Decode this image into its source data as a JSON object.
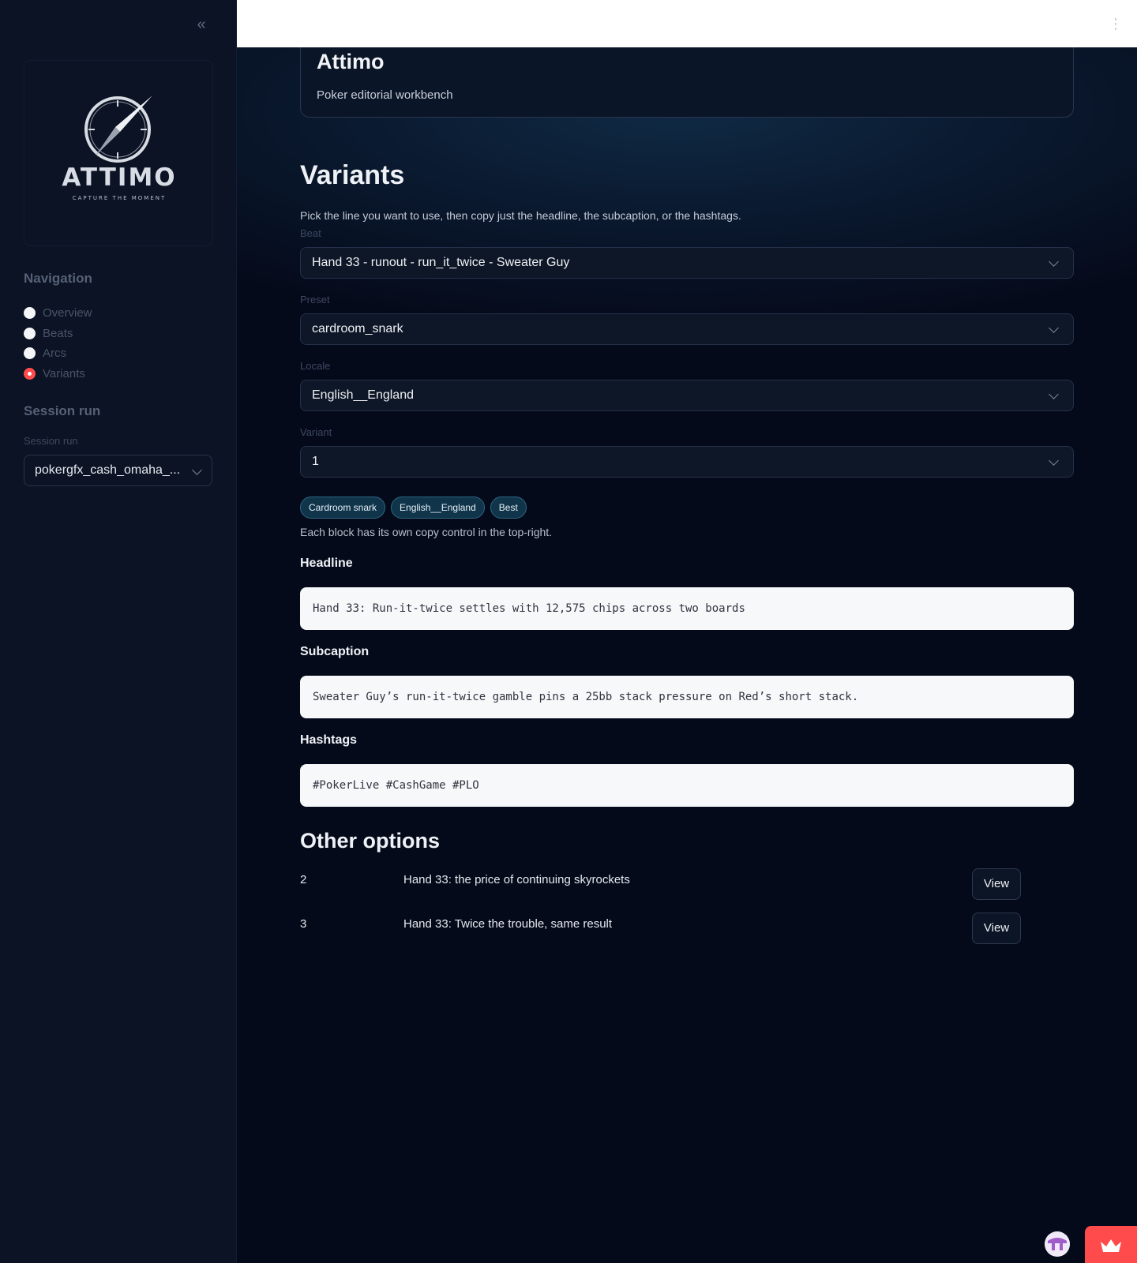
{
  "sidebar": {
    "logo": {
      "wordmark": "ATTIMO",
      "tagline": "CAPTURE THE MOMENT"
    },
    "navigation_heading": "Navigation",
    "nav_items": [
      {
        "label": "Overview",
        "selected": false
      },
      {
        "label": "Beats",
        "selected": false
      },
      {
        "label": "Arcs",
        "selected": false
      },
      {
        "label": "Variants",
        "selected": true
      }
    ],
    "session_heading": "Session run",
    "session_label": "Session run",
    "session_value": "pokergfx_cash_omaha_..."
  },
  "header": {
    "title": "Attimo",
    "subtitle": "Poker editorial workbench"
  },
  "main": {
    "title": "Variants",
    "intro": "Pick the line you want to use, then copy just the headline, the subcaption, or the hashtags.",
    "fields": {
      "beat": {
        "label": "Beat",
        "value": "Hand 33 - runout - run_it_twice - Sweater Guy"
      },
      "preset": {
        "label": "Preset",
        "value": "cardroom_snark"
      },
      "locale": {
        "label": "Locale",
        "value": "English__England"
      },
      "variant": {
        "label": "Variant",
        "value": "1"
      }
    },
    "chips": [
      "Cardroom snark",
      "English__England",
      "Best"
    ],
    "note": "Each block has its own copy control in the top-right.",
    "headline": {
      "label": "Headline",
      "text": "Hand 33: Run-it-twice settles with 12,575 chips across two boards"
    },
    "subcaption": {
      "label": "Subcaption",
      "text": "Sweater Guy’s run-it-twice gamble pins a 25bb stack pressure on Red’s short stack."
    },
    "hashtags": {
      "label": "Hashtags",
      "text": "#PokerLive #CashGame #PLO"
    },
    "other_options": {
      "title": "Other options",
      "rows": [
        {
          "num": "2",
          "text": "Hand 33: the price of continuing skyrockets",
          "button": "View"
        },
        {
          "num": "3",
          "text": "Hand 33: Twice the trouble, same result",
          "button": "View"
        }
      ]
    }
  },
  "colors": {
    "sidebar_bg": "#0b1324",
    "main_bg": "#050a1a",
    "accent_red": "#ff4b4b",
    "chip_bg": "#10344a",
    "code_bg": "#f7f8fa"
  },
  "icons": {
    "collapse": "double-chevron-left-icon",
    "menu": "vertical-dots-icon",
    "dropdown": "chevron-down-icon",
    "logo": "compass-icon",
    "footer_left": "avatar-icon",
    "footer_right": "crown-icon"
  }
}
